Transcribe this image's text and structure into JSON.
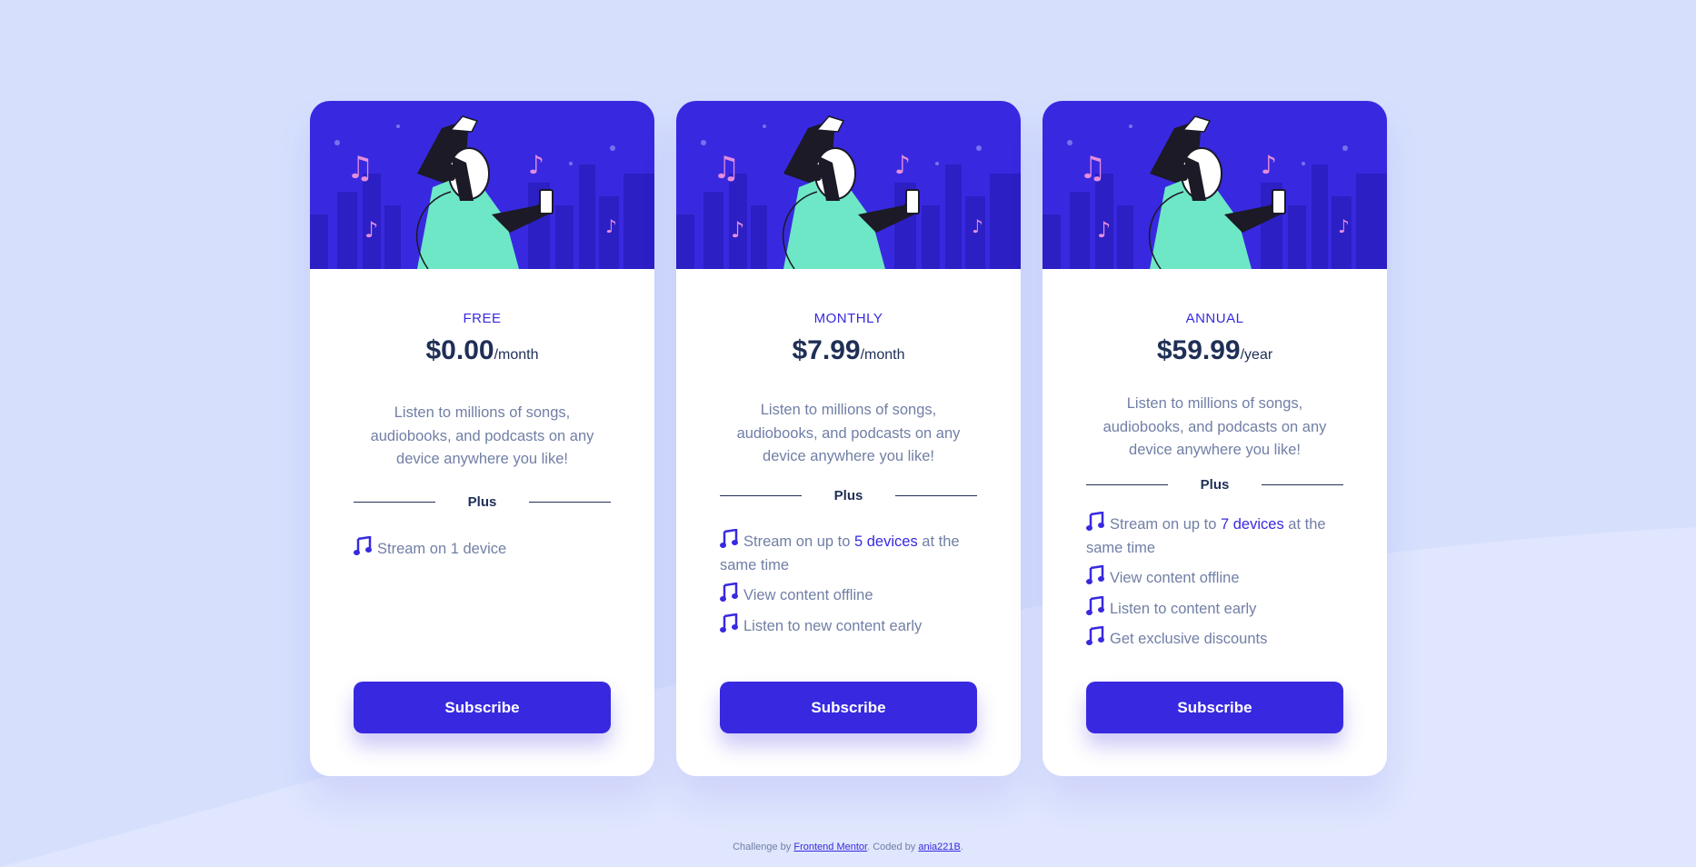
{
  "plans": [
    {
      "name": "FREE",
      "price": "$0.00",
      "period": "/month",
      "description": "Listen to millions of songs, audiobooks, and podcasts on any device anywhere you like!",
      "divider_label": "Plus",
      "features": [
        {
          "pre": "Stream on 1 device",
          "hl": "",
          "post": ""
        }
      ],
      "button_label": "Subscribe"
    },
    {
      "name": "MONTHLY",
      "price": "$7.99",
      "period": "/month",
      "description": "Listen to millions of songs, audiobooks, and podcasts on any device anywhere you like!",
      "divider_label": "Plus",
      "features": [
        {
          "pre": "Stream on up to ",
          "hl": "5 devices",
          "post": " at the same time"
        },
        {
          "pre": "View content offline",
          "hl": "",
          "post": ""
        },
        {
          "pre": "Listen to new content early",
          "hl": "",
          "post": ""
        }
      ],
      "button_label": "Subscribe"
    },
    {
      "name": "ANNUAL",
      "price": "$59.99",
      "period": "/year",
      "description": "Listen to millions of songs, audiobooks, and podcasts on any device anywhere you like!",
      "divider_label": "Plus",
      "features": [
        {
          "pre": "Stream on up to ",
          "hl": "7 devices",
          "post": " at the same time"
        },
        {
          "pre": "View content offline",
          "hl": "",
          "post": ""
        },
        {
          "pre": "Listen to content early",
          "hl": "",
          "post": ""
        },
        {
          "pre": "Get exclusive discounts",
          "hl": "",
          "post": ""
        }
      ],
      "button_label": "Subscribe"
    }
  ],
  "footer": {
    "prefix": "Challenge by ",
    "link1": "Frontend Mentor",
    "middle": ". Coded by ",
    "link2": "ania221B",
    "suffix": "."
  },
  "colors": {
    "page_bg": "#d6e0fd",
    "accent": "#3829e0",
    "heading": "#1f2f56",
    "muted": "#717fa6",
    "hero_bg": "#3829e0",
    "figure_shirt": "#6ee7c6",
    "music_note": "#e58ddc"
  },
  "icons": [
    "music-note-icon",
    "hero-illustration"
  ]
}
